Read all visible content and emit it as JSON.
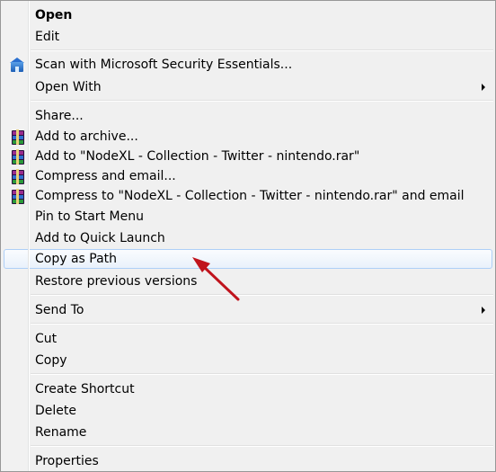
{
  "context_menu": {
    "items": [
      {
        "label": "Open",
        "bold": true
      },
      {
        "label": "Edit"
      },
      {
        "label": "Scan with Microsoft Security Essentials...",
        "icon": "microsoft-security-essentials-icon"
      },
      {
        "label": "Open With",
        "submenu": true
      },
      {
        "label": "Share..."
      },
      {
        "label": "Add to archive...",
        "icon": "winrar-icon"
      },
      {
        "label": "Add to \"NodeXL - Collection - Twitter - nintendo.rar\"",
        "icon": "winrar-icon"
      },
      {
        "label": "Compress and email...",
        "icon": "winrar-icon"
      },
      {
        "label": "Compress to \"NodeXL - Collection - Twitter - nintendo.rar\" and email",
        "icon": "winrar-icon"
      },
      {
        "label": "Pin to Start Menu"
      },
      {
        "label": "Add to Quick Launch"
      },
      {
        "label": "Copy as Path",
        "highlighted": true
      },
      {
        "label": "Restore previous versions"
      },
      {
        "label": "Send To",
        "submenu": true
      },
      {
        "label": "Cut"
      },
      {
        "label": "Copy"
      },
      {
        "label": "Create Shortcut"
      },
      {
        "label": "Delete"
      },
      {
        "label": "Rename"
      },
      {
        "label": "Properties"
      }
    ]
  },
  "annotation": {
    "arrow_color": "#c0141d",
    "points_to": "Copy as Path"
  },
  "colors": {
    "menu_background": "#f0f0f0",
    "highlight_border": "#aecff7",
    "separator": "#e0e0e0"
  }
}
